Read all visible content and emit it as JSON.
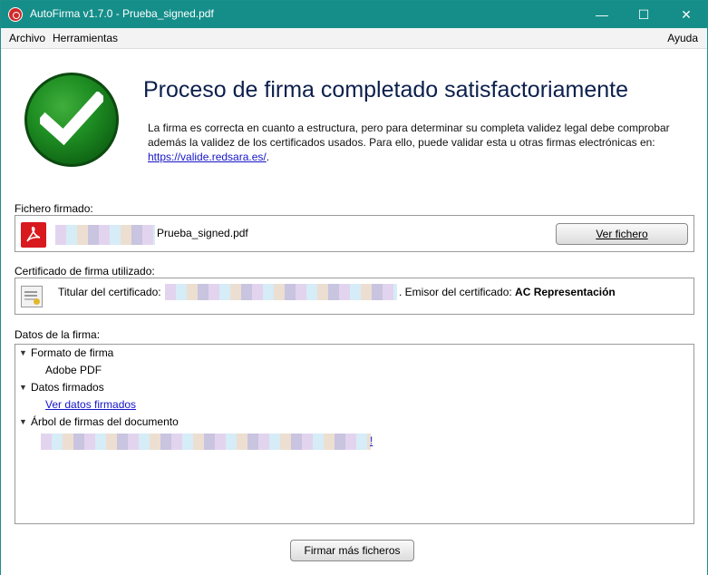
{
  "window": {
    "title": "AutoFirma v1.7.0 - Prueba_signed.pdf",
    "min_glyph": "—",
    "max_glyph": "☐",
    "close_glyph": "✕"
  },
  "menu": {
    "archivo": "Archivo",
    "herramientas": "Herramientas",
    "ayuda": "Ayuda"
  },
  "result": {
    "heading": "Proceso de firma completado satisfactoriamente",
    "desc_text": "La firma es correcta en cuanto a estructura, pero para determinar su completa validez legal debe comprobar además la validez de los certificados usados. Para ello, puede validar esta u otras firmas electrónicas en: ",
    "desc_link": "https://valide.redsara.es/",
    "desc_end": "."
  },
  "file_section": {
    "label": "Fichero firmado:",
    "file_name": "Prueba_signed.pdf",
    "view_button": "Ver fichero"
  },
  "cert_section": {
    "label": "Certificado de firma utilizado:",
    "titular_label": "Titular del certificado:",
    "emisor_label": ". Emisor del certificado: ",
    "emisor_value": "AC Representación"
  },
  "signature_data": {
    "label": "Datos de la firma:",
    "format_title": "Formato de firma",
    "format_value": "Adobe PDF",
    "signed_title": "Datos firmados",
    "signed_link": "Ver datos firmados",
    "tree_title": "Árbol de firmas del documento",
    "tree_link_tail": "!"
  },
  "sign_more_button": "Firmar más ficheros",
  "colors": {
    "titlebar": "#158e8a",
    "link": "#1515c8",
    "heading": "#0c1f4d",
    "badge": "#1f8e23"
  }
}
